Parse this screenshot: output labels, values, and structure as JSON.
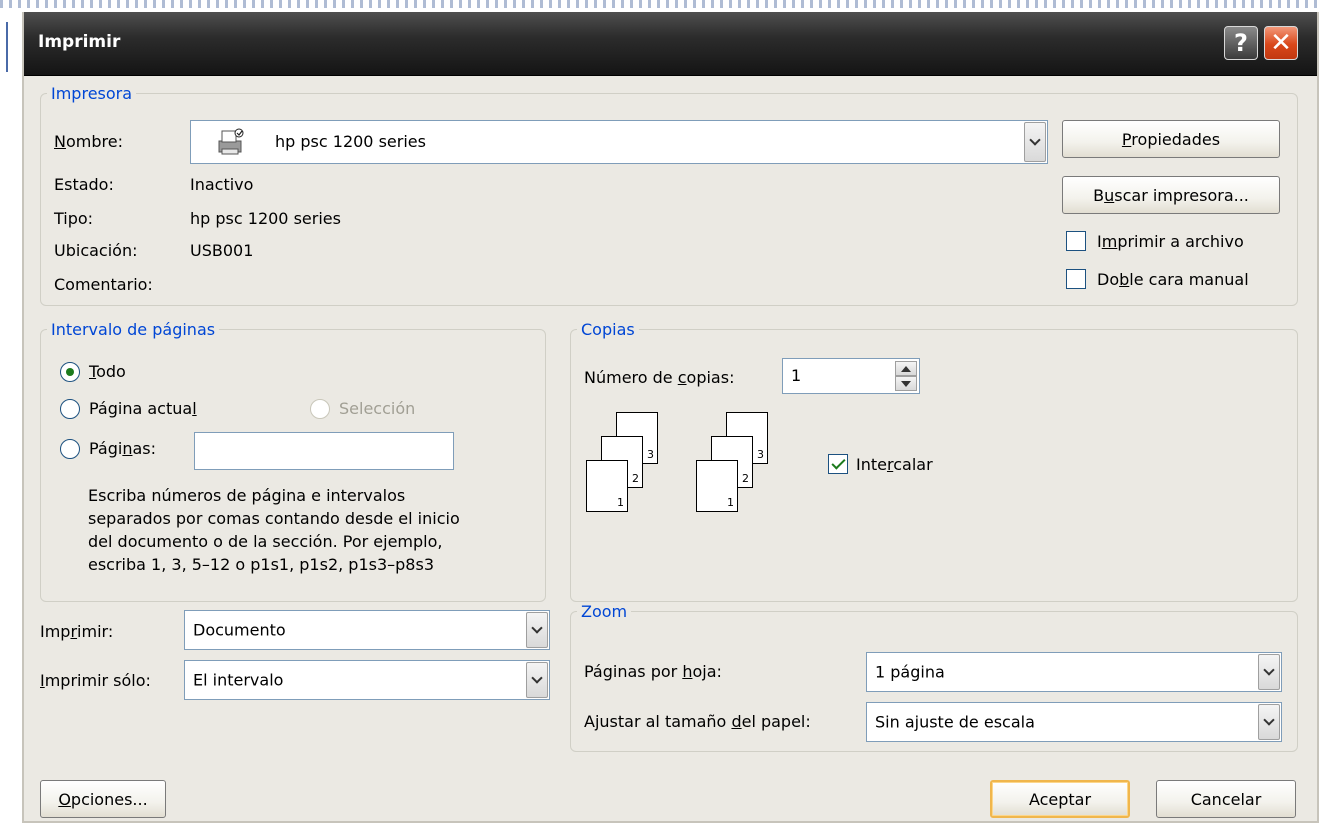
{
  "window": {
    "title": "Imprimir",
    "help_glyph": "?",
    "close_glyph": "✕"
  },
  "printer": {
    "legend": "Impresora",
    "name_label": "Nombre:",
    "name_value": "hp psc 1200 series",
    "status_label": "Estado:",
    "status_value": "Inactivo",
    "type_label": "Tipo:",
    "type_value": "hp psc 1200 series",
    "location_label": "Ubicación:",
    "location_value": "USB001",
    "comment_label": "Comentario:",
    "comment_value": "",
    "properties_button": "Propiedades",
    "find_printer_button": "Buscar impresora...",
    "print_to_file": {
      "label": "Imprimir a archivo",
      "checked": false
    },
    "manual_duplex": {
      "label": "Doble cara manual",
      "checked": false
    }
  },
  "page_range": {
    "legend": "Intervalo de páginas",
    "all_label": "Todo",
    "current_page_label": "Página actual",
    "selection_label": "Selección",
    "pages_label": "Páginas:",
    "pages_value": "",
    "selected": "all",
    "help_lines": [
      "Escriba números de página e intervalos",
      "separados por comas contando desde el inicio",
      "del documento o de la sección. Por ejemplo,",
      "escriba 1, 3, 5–12 o p1s1, p1s2, p1s3–p8s3"
    ]
  },
  "copies": {
    "legend": "Copias",
    "number_label": "Número de copias:",
    "number_value": "1",
    "collate": {
      "label": "Intercalar",
      "checked": true
    },
    "page_icon_numbers": [
      "3",
      "2",
      "1"
    ]
  },
  "print_what": {
    "print_label": "Imprimir:",
    "print_value": "Documento",
    "print_only_label": "Imprimir sólo:",
    "print_only_value": "El intervalo"
  },
  "zoom": {
    "legend": "Zoom",
    "pages_per_sheet_label": "Páginas por hoja:",
    "pages_per_sheet_value": "1 página",
    "scale_label": "Ajustar al tamaño del papel:",
    "scale_value": "Sin ajuste de escala"
  },
  "footer": {
    "options_button": "Opciones...",
    "ok_button": "Aceptar",
    "cancel_button": "Cancelar"
  },
  "colors": {
    "group_legend": "#0046d5",
    "titlebar": "#1e1e1e",
    "close_button": "#d9471a",
    "dialog_background": "#ebe9e3",
    "default_button_border": "#f0b64c"
  }
}
